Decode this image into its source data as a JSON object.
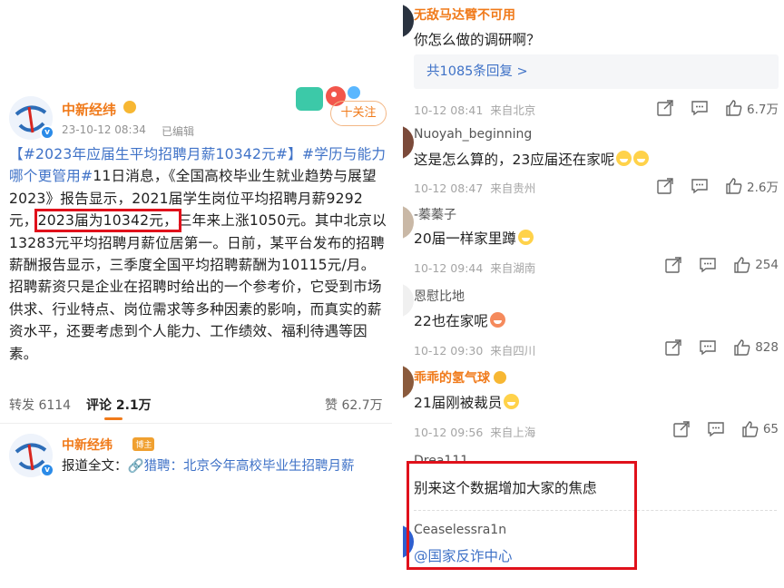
{
  "post": {
    "author": "中新经纬",
    "time": "23-10-12 08:34",
    "edited": "已编辑",
    "follow_label": "十关注",
    "text": {
      "t1": "【#2023年应届生平均招聘月薪10342元#】",
      "t2": "#学历与能力哪个更管用#",
      "t3": "11日消息，《全国高校毕业生就业趋势与展望2023》报告显示，2021届学生岗位平均招聘月薪9292元，",
      "t4": "2023届为10342元，",
      "t5": "三年来上涨1050元。其中北京以13283元平均招聘月薪位居第一。日前，某平台发布的招聘薪酬报告显示，三季度全国平均招聘薪酬为10115元/月。招聘薪资只是企业在招聘时给出的一个参考价，它受到市场供求、行业特点、岗位需求等多种因素的影响，而真实的薪资水平，还要考虑到个人能力、工作绩效、福利待遇等因素。"
    },
    "actions": {
      "repost": "转发 6114",
      "comment": "评论 2.1万",
      "like": "赞 62.7万"
    }
  },
  "reply_post": {
    "author": "中新经纬",
    "badge": "博主",
    "body_prefix": "报道全文：",
    "link_icon": "🔗",
    "link_text": "猎聘：北京今年高校毕业生招聘月薪"
  },
  "comments": [
    {
      "name": "无敌马达臂不可用",
      "text": "你怎么做的调研啊？",
      "replies": "共1085条回复 >",
      "time": "10-12 08:41",
      "loc": "来自北京",
      "likes": "6.7万"
    },
    {
      "name": "Nuoyah_beginning",
      "text": "这是怎么算的，23应届还在家呢",
      "time": "10-12 08:47",
      "loc": "来自贵州",
      "likes": "2.6万"
    },
    {
      "name": "-蓁蓁子",
      "text": "20届一样家里蹲",
      "time": "10-12 09:44",
      "loc": "来自湖南",
      "likes": "254"
    },
    {
      "name": "恩慰比地",
      "text": "22也在家呢",
      "time": "10-12 09:30",
      "loc": "来自四川",
      "likes": "828"
    },
    {
      "name": "乖乖的氢气球",
      "text": "21届刚被裁员",
      "time": "10-12 09:56",
      "loc": "来自上海",
      "likes": "65"
    },
    {
      "name": "Drea111",
      "text": "别来这个数据增加大家的焦虑"
    },
    {
      "name": "Ceaselessra1n",
      "text": "@国家反诈中心"
    }
  ],
  "colors": {
    "accent_orange": "#f07a1a",
    "link_blue": "#3f72c7",
    "highlight_red": "#e0111b"
  }
}
